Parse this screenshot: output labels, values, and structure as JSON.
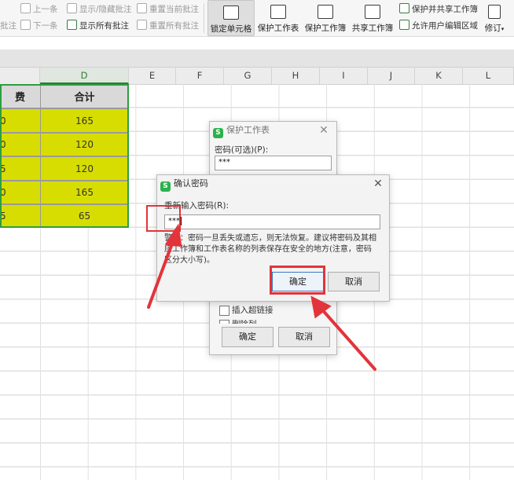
{
  "ribbon": {
    "row1": [
      "上一条",
      "显示/隐藏批注",
      "重置当前批注"
    ],
    "row2": [
      "下一条",
      "显示所有批注",
      "重置所有批注"
    ],
    "left_cut_1": "批注",
    "big_buttons": [
      "锁定单元格",
      "保护工作表",
      "保护工作簿",
      "共享工作簿"
    ],
    "right_top": "保护并共享工作簿",
    "right_bottom": "允许用户编辑区域",
    "revise": "修订"
  },
  "columns": [
    "E",
    "F",
    "G",
    "H",
    "I",
    "J",
    "K",
    "L"
  ],
  "selected_column": "D",
  "table": {
    "header_left": "费",
    "header_right": "合计",
    "left_cells": [
      "0",
      "0",
      "5",
      "0",
      "5"
    ],
    "values": [
      "165",
      "120",
      "120",
      "165",
      "65"
    ]
  },
  "protect_dialog": {
    "title": "保护工作表",
    "password_label": "密码(可选)(P):",
    "password_value": "***",
    "checkbox_insert_link": "插入超链接",
    "checkbox_delete_col": "删除列",
    "ok": "确定",
    "cancel": "取消"
  },
  "confirm_dialog": {
    "title": "确认密码",
    "prompt": "重新输入密码(R):",
    "value": "***",
    "warning_line1": "警告：密码一旦丢失或遗忘，则无法恢复。建议将密码及其相",
    "warning_line2": "应工作簿和工作表名称的列表保存在安全的地方(注意，密码",
    "warning_line3": "区分大小写)。",
    "ok": "确定",
    "cancel": "取消"
  },
  "accent": {
    "green": "#2e9e3e",
    "yellow": "#d7dd00",
    "red": "#e2343a"
  }
}
